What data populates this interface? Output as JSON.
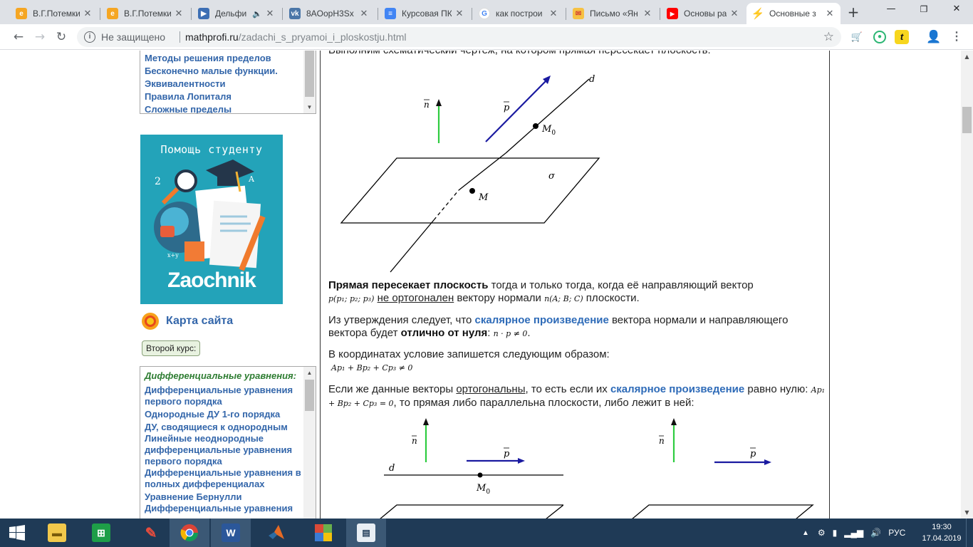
{
  "browser": {
    "tabs": [
      {
        "label": "В.Г.Потемки",
        "favicon": "document-icon",
        "color": "#f5a623"
      },
      {
        "label": "В.Г.Потемки",
        "favicon": "document-icon",
        "color": "#f5a623"
      },
      {
        "label": "Дельфи",
        "favicon": "play-icon",
        "color": "#3d6fb4"
      },
      {
        "label": "8AOорН3Sх",
        "favicon": "vk-icon",
        "color": "#4a76a8"
      },
      {
        "label": "Курсовая ПК",
        "favicon": "doc-icon",
        "color": "#4285f4"
      },
      {
        "label": "как построи",
        "favicon": "google-icon",
        "color": "#ffffff"
      },
      {
        "label": "Письмо «Ян",
        "favicon": "mail-icon",
        "color": "#f6c143"
      },
      {
        "label": "Основы раб",
        "favicon": "youtube-icon",
        "color": "#ff0000"
      },
      {
        "label": "Основные з",
        "favicon": "lightning-icon",
        "color": "#d62d20",
        "active": true
      }
    ],
    "address": {
      "security": "Не защищено",
      "host": "mathprofi.ru",
      "path": "/zadachi_s_pryamoi_i_ploskostju.html"
    }
  },
  "sidebar": {
    "top_list": [
      "Методы решения пределов",
      "Бесконечно малые функции.",
      "Эквивалентности",
      "Правила Лопиталя",
      "Сложные пределы"
    ],
    "banner_title": "Помощь студенту",
    "banner_brand": "Zaochnik",
    "sitemap_label": "Карта сайта",
    "course_button": "Второй курс:",
    "bottom_list": {
      "heading": "Дифференциальные уравнения:",
      "items": [
        "Дифференциальные уравнения первого порядка",
        "Однородные ДУ 1-го порядка",
        "ДУ, сводящиеся к однородным",
        "Линейные неоднородные дифференциальные уравнения первого порядка",
        "Дифференциальные уравнения в полных дифференциалах",
        "Уравнение Бернулли",
        "Дифференциальные уравнения"
      ]
    }
  },
  "content": {
    "cut_text": "Выполним схематический чертеж, на котором прямая пересекает плоскость:",
    "fig1": {
      "d": "d",
      "n": "n",
      "p": "p",
      "m0": "M",
      "m0_sub": "0",
      "m": "M",
      "sigma": "σ"
    },
    "p1": {
      "bold": "Прямая пересекает плоскость",
      "t1": " тогда и только тогда, когда её направляющий вектор",
      "f1": "p(p₁; p₂; p₃)",
      "u1": "не ортогонален",
      "t2": " вектору нормали ",
      "f2": "n(A; B; C)",
      "t3": " плоскости."
    },
    "p2": {
      "t1": "Из утверждения следует, что ",
      "l1": "скалярное произведение",
      "t2": " вектора нормали и направляющего вектора будет ",
      "b1": "отлично от нуля",
      "t3": ": ",
      "f1": "n · p ≠ 0",
      "t4": "."
    },
    "p3": {
      "t1": "В координатах условие запишется следующим образом:",
      "f1": "Ap₁ + Bp₂ + Cp₃ ≠ 0"
    },
    "p4": {
      "t1": "Если же данные векторы ",
      "u1": "ортогональны",
      "t2": ", то есть если их ",
      "l1": "скалярное произведение",
      "t3": " равно нулю: ",
      "f1": "Ap₁ + Bp₂ + Cp₃ = 0",
      "t4": ", то прямая либо параллельна плоскости, либо лежит в ней:"
    },
    "fig2": {
      "d": "d",
      "n": "n",
      "p": "p",
      "m0": "M",
      "m0_sub": "0"
    },
    "fig3": {
      "n": "n",
      "p": "p"
    }
  },
  "taskbar": {
    "apps": [
      "start-icon",
      "explorer-icon",
      "store-icon",
      "paint-icon",
      "chrome-icon",
      "word-icon",
      "matlab-icon",
      "winrar-icon",
      "app-icon"
    ],
    "language": "РУС",
    "time": "19:30",
    "date": "17.04.2019"
  }
}
